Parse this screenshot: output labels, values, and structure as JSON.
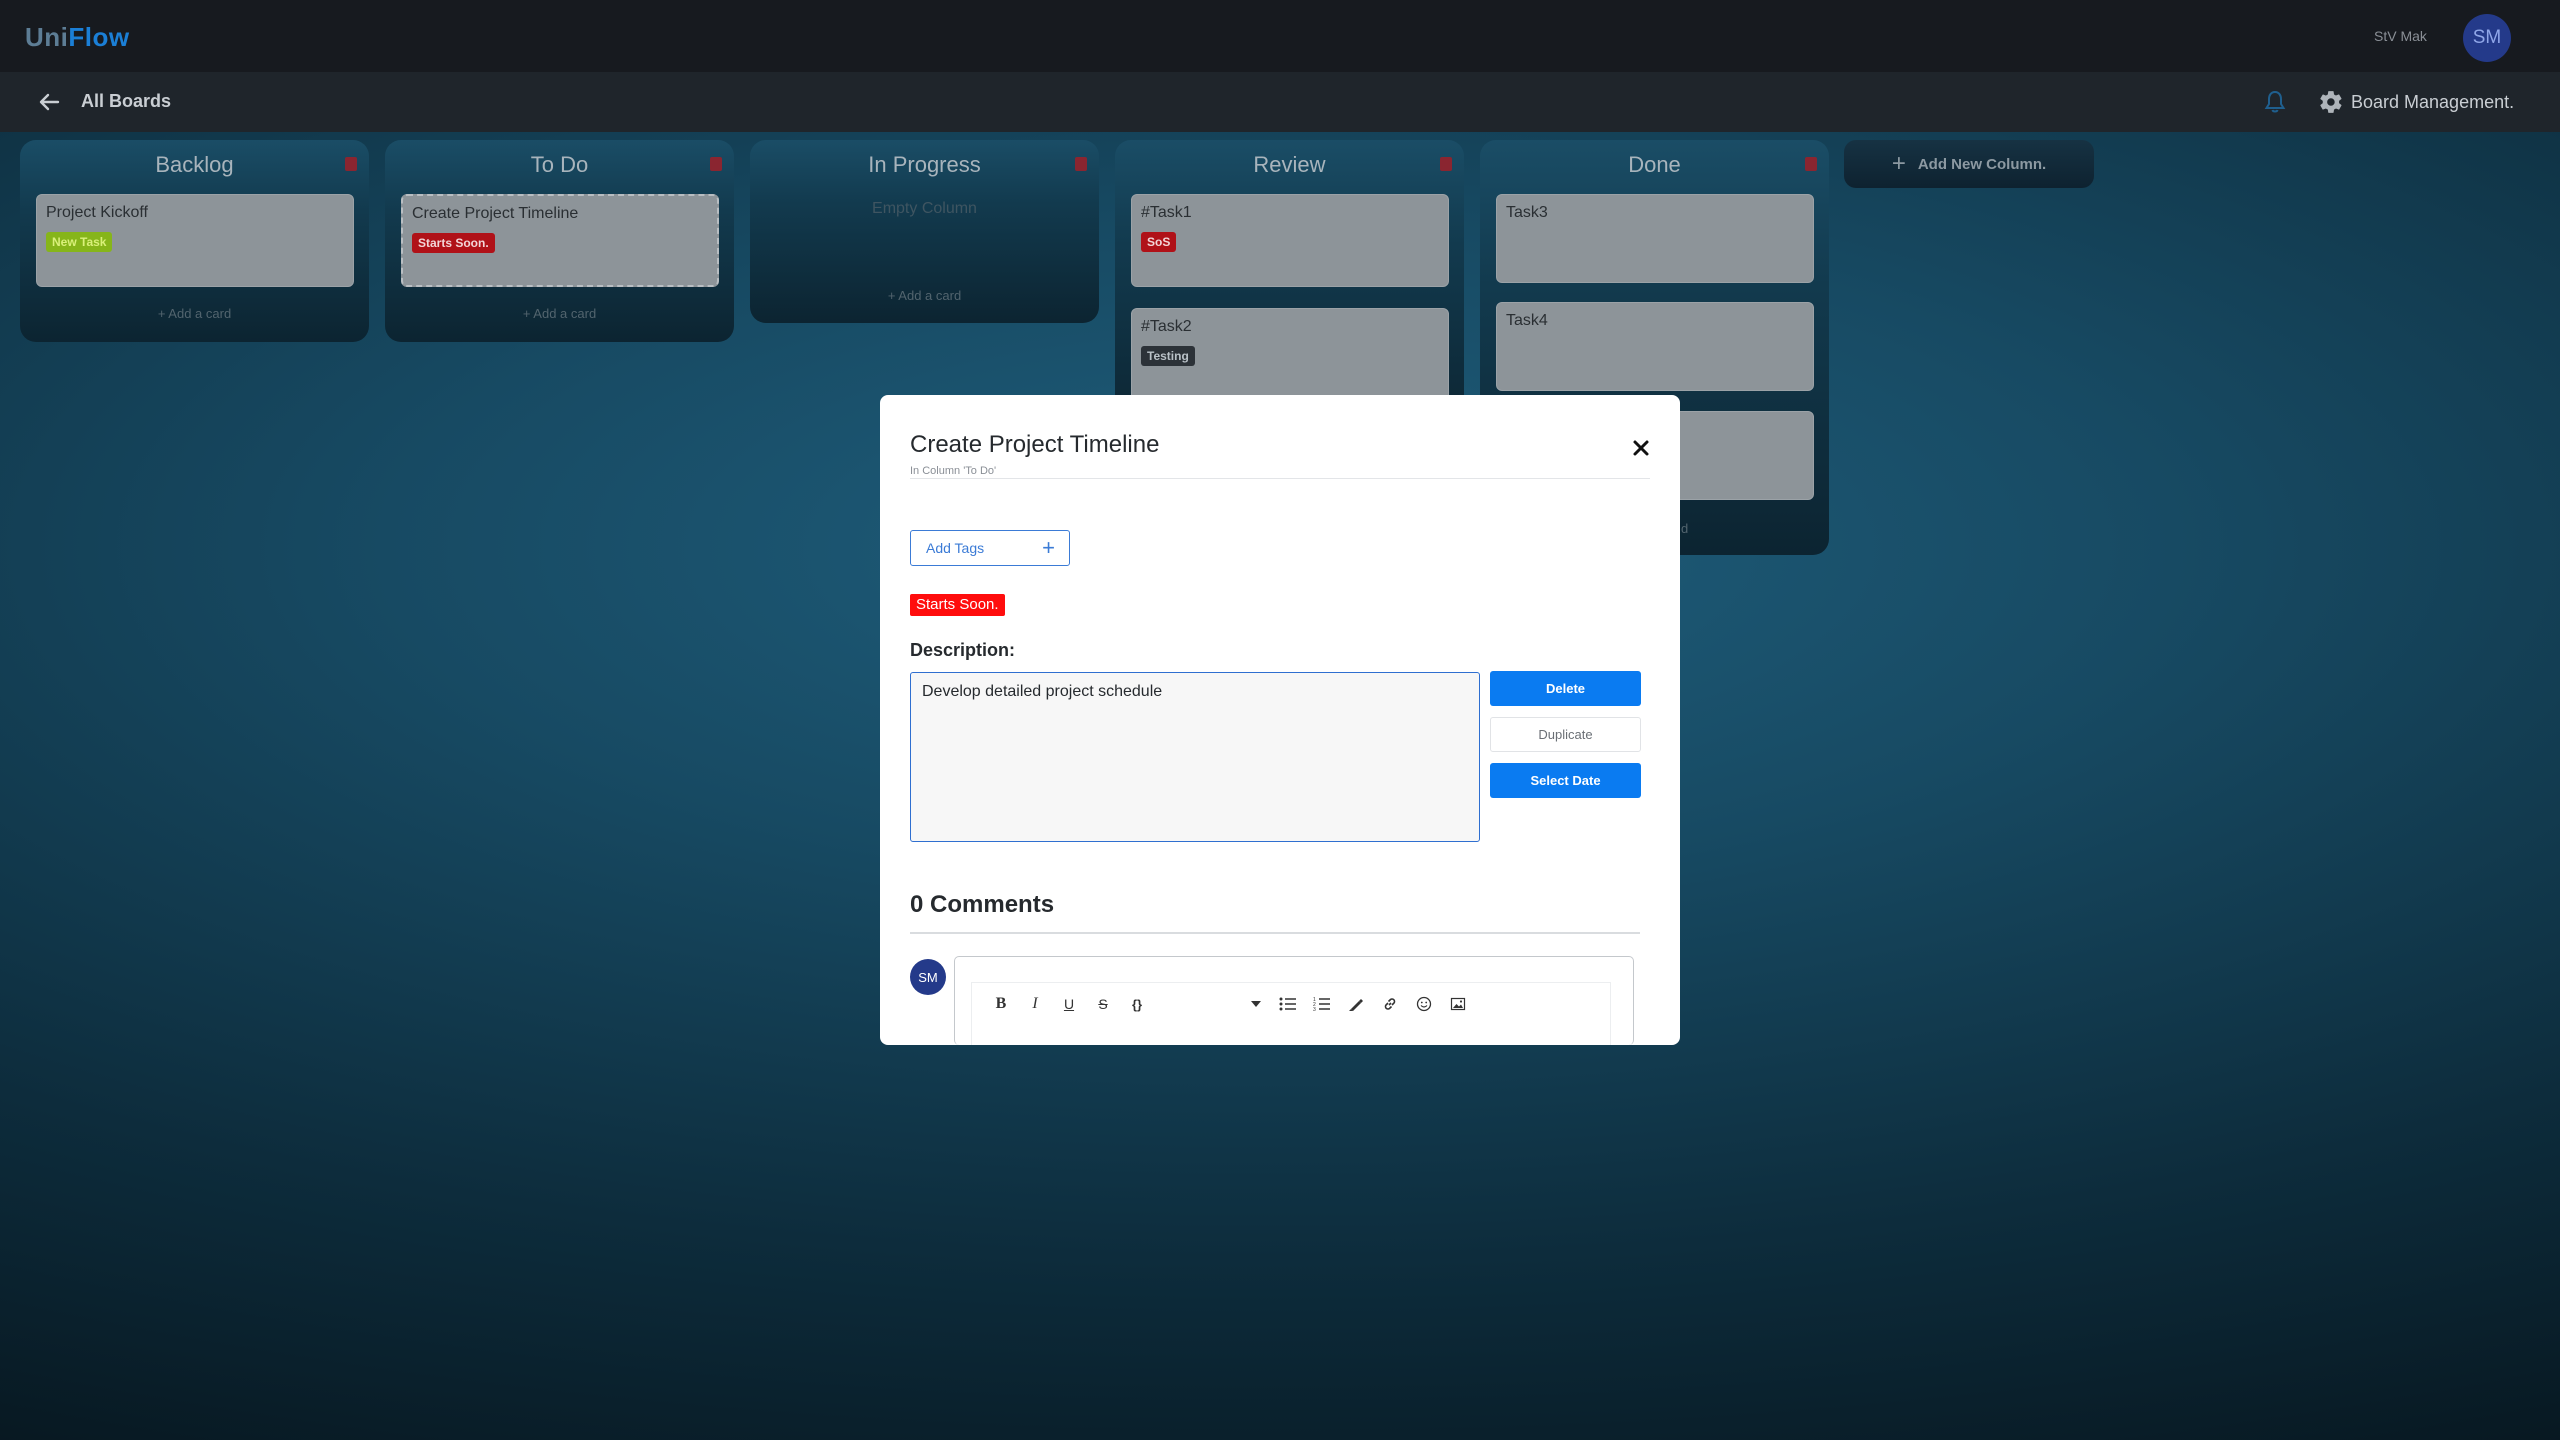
{
  "app": {
    "logo_uni": "Uni",
    "logo_flow": "Flow",
    "user_name": "StV Mak",
    "user_initials": "SM"
  },
  "subheader": {
    "back_label": "All Boards",
    "board_management": "Board Management."
  },
  "board": {
    "columns": [
      {
        "title": "Backlog",
        "cards": [
          {
            "title": "Project Kickoff",
            "tag": "New Task",
            "tag_color": "#9bcf1c"
          }
        ],
        "add_card": "+ Add a card"
      },
      {
        "title": "To Do",
        "cards": [
          {
            "title": "Create Project Timeline",
            "tag": "Starts Soon.",
            "tag_color": "#e3131b"
          }
        ],
        "add_card": "+ Add a card"
      },
      {
        "title": "In Progress",
        "cards": [],
        "empty": "Empty Column",
        "add_card": "+ Add a card"
      },
      {
        "title": "Review",
        "cards": [
          {
            "title": "#Task1",
            "tag": "SoS",
            "tag_color": "#e3131b"
          },
          {
            "title": "#Task2",
            "tag": "Testing",
            "tag_color": "#2c3238"
          }
        ]
      },
      {
        "title": "Done",
        "cards": [
          {
            "title": "Task3"
          },
          {
            "title": "Task4"
          },
          {
            "title": ""
          }
        ],
        "add_card_fragment": "d"
      }
    ],
    "add_column": "Add New Column."
  },
  "modal": {
    "title": "Create Project Timeline",
    "subtitle": "In Column 'To Do'",
    "add_tags": "Add Tags",
    "tag": "Starts Soon.",
    "tag_color": "#ff0d0d",
    "description_label": "Description:",
    "description": "Develop detailed project schedule",
    "buttons": {
      "delete": "Delete",
      "duplicate": "Duplicate",
      "select_date": "Select Date"
    },
    "comments_title": "0 Comments",
    "commenter_initials": "SM",
    "toolbar": {
      "bold": "B",
      "italic": "I",
      "underline": "U",
      "strike": "S",
      "code": "{}"
    }
  },
  "colors": {
    "accent": "#0a7bf1",
    "danger": "#ff0d0d",
    "logo_flow": "#1b7fd6"
  }
}
